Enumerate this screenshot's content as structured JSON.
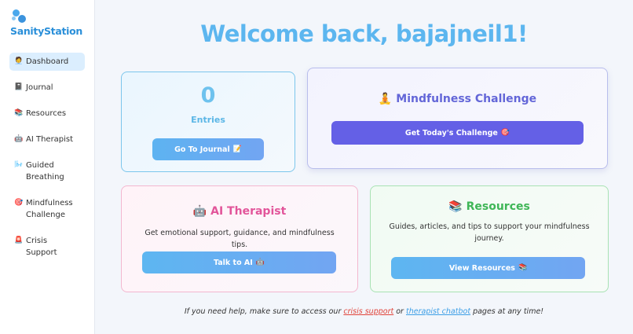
{
  "app": {
    "name": "SanityStation"
  },
  "sidebar": {
    "items": [
      {
        "label": "Dashboard",
        "icon": "🧑‍💼"
      },
      {
        "label": "Journal",
        "icon": "📓"
      },
      {
        "label": "Resources",
        "icon": "📚"
      },
      {
        "label": "AI Therapist",
        "icon": "🤖"
      },
      {
        "label": "Guided Breathing",
        "icon": "🌬️"
      },
      {
        "label": "Mindfulness Challenge",
        "icon": "🎯"
      },
      {
        "label": "Crisis Support",
        "icon": "🚨"
      }
    ]
  },
  "main": {
    "welcome": "Welcome back, bajajneil1!",
    "entries": {
      "count": "0",
      "label": "Entries",
      "button": "Go To Journal",
      "button_icon": "📝"
    },
    "mindfulness": {
      "icon": "🧘",
      "title": "Mindfulness Challenge",
      "button": "Get Today's Challenge",
      "button_icon": "🎯"
    },
    "ai_therapist": {
      "icon": "🤖",
      "title": "AI Therapist",
      "description": "Get emotional support, guidance, and mindfulness tips.",
      "button": "Talk to AI",
      "button_icon": "🤖"
    },
    "resources": {
      "icon": "📚",
      "title": "Resources",
      "description": "Guides, articles, and tips to support your mindfulness journey.",
      "button": "View Resources",
      "button_icon": "📚"
    },
    "footer": {
      "prefix": "If you need help, make sure to access our",
      "crisis_link": "crisis support",
      "middle": "or",
      "chat_link": "therapist chatbot",
      "suffix": "pages at any time!"
    }
  },
  "colors": {
    "accent": "#5cb6ef",
    "challenge_button": "#6460e6",
    "crisis_link": "#e0443b"
  }
}
